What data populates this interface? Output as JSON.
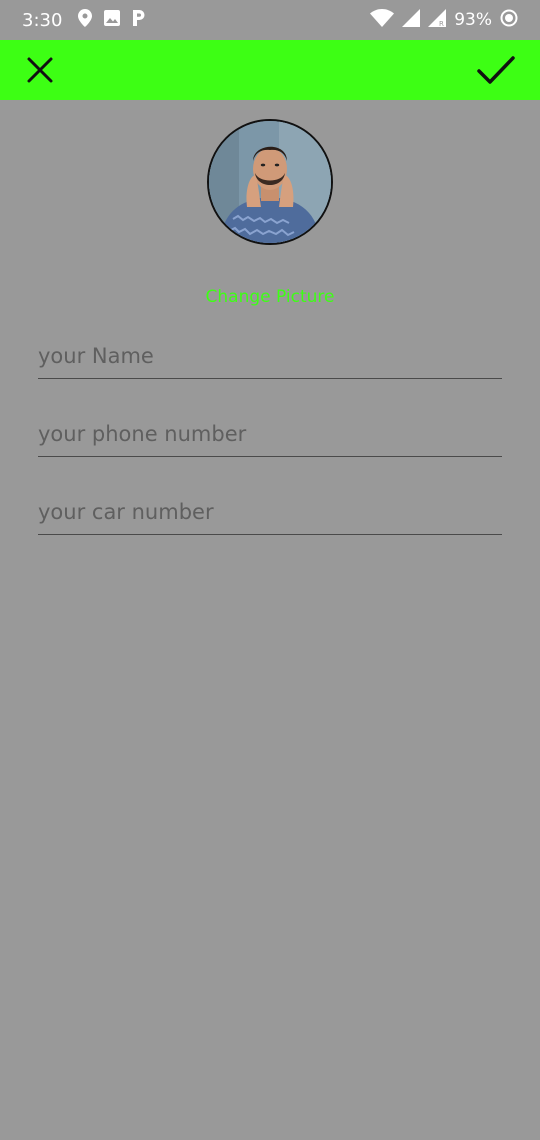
{
  "status_bar": {
    "time": "3:30",
    "battery": "93%",
    "icons": [
      "location-icon",
      "image-icon",
      "parking-icon",
      "wifi-icon",
      "signal-icon",
      "signal-roaming-icon",
      "battery-saver-icon"
    ]
  },
  "toolbar": {
    "color": "#3dff14",
    "close_icon": "close-icon",
    "confirm_icon": "check-icon"
  },
  "profile": {
    "change_picture_label": "Change Picture"
  },
  "form": {
    "name_placeholder": "your Name",
    "phone_placeholder": "your phone number",
    "car_placeholder": "your car number"
  }
}
